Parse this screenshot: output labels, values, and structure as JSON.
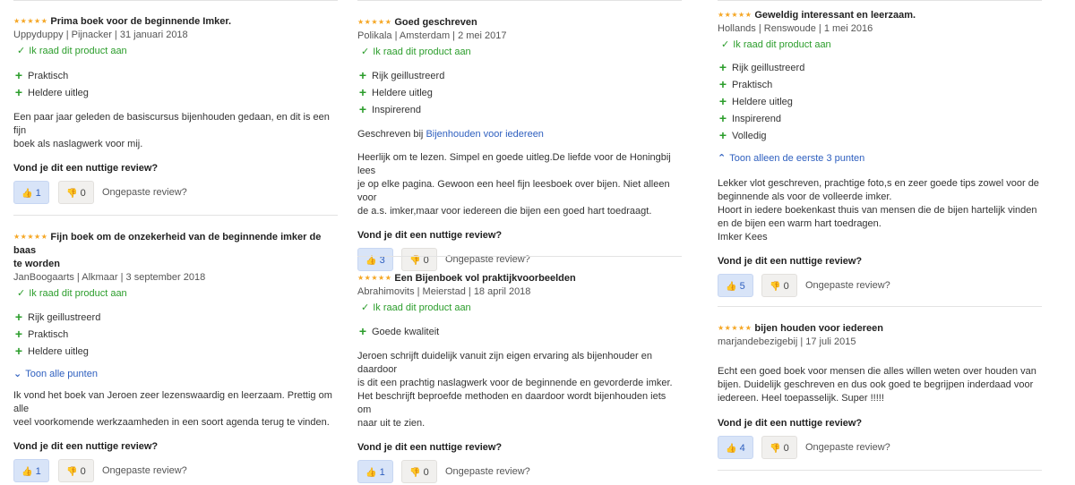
{
  "useful_question": "Vond je dit een nuttige review?",
  "report_label": "Ongepaste review?",
  "recommend_label": "Ik raad dit product aan",
  "reviews": [
    {
      "title": "Prima boek voor de beginnende Imker.",
      "meta": "Uppyduppy | Pijnacker | 31 januari 2018",
      "points": [
        "Praktisch",
        "Heldere uitleg"
      ],
      "body": [
        "Een paar jaar geleden de basiscursus bijenhouden gedaan, en dit is een fijn",
        "boek als naslagwerk voor mij."
      ],
      "up": "1",
      "down": "0"
    },
    {
      "title_lines": [
        "Fijn boek om de onzekerheid van de beginnende imker de baas",
        "te worden"
      ],
      "meta": "JanBoogaarts | Alkmaar | 3 september 2018",
      "points": [
        "Rijk geillustreerd",
        "Praktisch",
        "Heldere uitleg"
      ],
      "toggle": "Toon alle punten",
      "body": [
        "Ik vond het boek van Jeroen zeer lezenswaardig en leerzaam. Prettig om alle",
        "veel voorkomende werkzaamheden in een soort agenda terug te vinden."
      ],
      "up": "1",
      "down": "0"
    },
    {
      "title": "Goed geschreven",
      "meta": "Polikala | Amsterdam | 2 mei 2017",
      "points": [
        "Rijk geillustreerd",
        "Heldere uitleg",
        "Inspirerend"
      ],
      "source_prefix": "Geschreven bij",
      "source_link": "Bijenhouden voor iedereen",
      "body": [
        "Heerlijk om te lezen. Simpel en goede uitleg.De liefde voor de Honingbij lees",
        "je op elke pagina. Gewoon een heel fijn leesboek over bijen. Niet alleen voor",
        "de a.s. imker,maar voor iedereen die bijen een goed hart toedraagt."
      ],
      "up": "3",
      "down": "0"
    },
    {
      "title": "Een Bijenboek vol praktijkvoorbeelden",
      "meta": "Abrahimovits | Meierstad | 18 april 2018",
      "points": [
        "Goede kwaliteit"
      ],
      "body": [
        "Jeroen schrijft duidelijk vanuit zijn eigen ervaring als bijenhouder en daardoor",
        "is dit een prachtig naslagwerk voor de beginnende en gevorderde imker.",
        "Het beschrijft beproefde methoden en daardoor wordt bijenhouden iets om",
        "naar uit te zien."
      ],
      "up": "1",
      "down": "0"
    },
    {
      "title": "Geweldig interessant en leerzaam.",
      "meta": "Hollands | Renswoude | 1 mei 2016",
      "points": [
        "Rijk geillustreerd",
        "Praktisch",
        "Heldere uitleg",
        "Inspirerend",
        "Volledig"
      ],
      "toggle": "Toon alleen de eerste 3 punten",
      "body": [
        "Lekker vlot geschreven, prachtige foto,s en zeer goede tips zowel voor de",
        "beginnende als voor de volleerde imker.",
        "Hoort in iedere boekenkast thuis van mensen die de bijen hartelijk vinden",
        "en de bijen een warm hart toedragen.",
        "Imker Kees"
      ],
      "up": "5",
      "down": "0"
    },
    {
      "title": "bijen houden voor iedereen",
      "meta": "marjandebezigebij | 17 juli 2015",
      "body": [
        "Echt een goed boek voor mensen die alles willen weten over houden van",
        "bijen. Duidelijk geschreven en dus ook goed te begrijpen inderdaad voor",
        "iedereen. Heel toepasselijk. Super !!!!!"
      ],
      "up": "4",
      "down": "0"
    }
  ],
  "colors": {
    "star": "#f5a623",
    "recommend_green": "#2b9d2b",
    "link_blue": "#2e5fbf",
    "helpful_bg": "#d8e4f8",
    "unhelpful_bg": "#f1f0ee"
  },
  "icons": {
    "star": "star-icon",
    "check": "check-icon",
    "plus": "plus-icon",
    "thumbs_up": "thumbs-up-icon",
    "thumbs_down": "thumbs-down-icon",
    "chevron_down": "chevron-down-icon",
    "chevron_up": "chevron-up-icon"
  }
}
